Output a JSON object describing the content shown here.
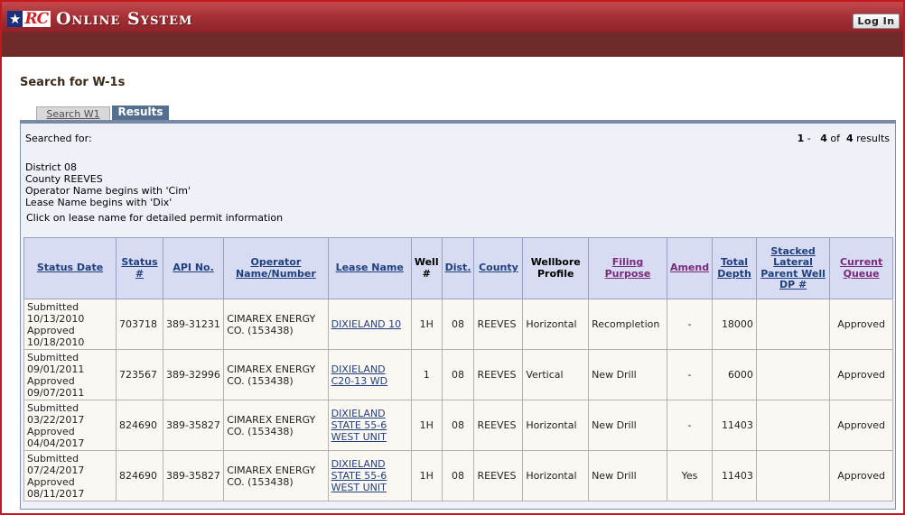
{
  "app": {
    "logo_star": "★",
    "logo_text": "RC",
    "title": "Online System",
    "login_label": "Log In"
  },
  "page": {
    "heading": "Search for W-1s"
  },
  "tabs": [
    {
      "label": "Search W1"
    },
    {
      "label": "Results"
    }
  ],
  "summary": {
    "searched_for": "Searched for:",
    "range_start": "1",
    "range_sep": "-",
    "range_end": "4",
    "of_label": "of",
    "total": "4",
    "results_label": "results"
  },
  "criteria": [
    "District 08",
    "County REEVES",
    "Operator Name begins with 'Cim'",
    "Lease Name begins with 'Dix'"
  ],
  "click_note": "Click on lease name for detailed permit information",
  "columns": {
    "status_date": "Status Date",
    "status_num": "Status #",
    "api_no": "API No.",
    "operator": "Operator Name/Number",
    "lease_name": "Lease Name",
    "well_num": "Well #",
    "dist": "Dist.",
    "county": "County",
    "wellbore": "Wellbore Profile",
    "filing": "Filing Purpose",
    "amend": "Amend",
    "total_depth": "Total Depth",
    "stacked": "Stacked Lateral Parent Well DP #",
    "queue": "Current Queue"
  },
  "rows": [
    {
      "submitted_label": "Submitted",
      "submitted_date": "10/13/2010",
      "approved_label": "Approved",
      "approved_date": "10/18/2010",
      "status_num": "703718",
      "api_no": "389-31231",
      "operator": "CIMAREX ENERGY CO. (153438)",
      "lease_name": "DIXIELAND 10",
      "well_num": "1H",
      "dist": "08",
      "county": "REEVES",
      "wellbore": "Horizontal",
      "filing": "Recompletion",
      "amend": "-",
      "total_depth": "18000",
      "stacked": "",
      "queue": "Approved"
    },
    {
      "submitted_label": "Submitted",
      "submitted_date": "09/01/2011",
      "approved_label": "Approved",
      "approved_date": "09/07/2011",
      "status_num": "723567",
      "api_no": "389-32996",
      "operator": "CIMAREX ENERGY CO. (153438)",
      "lease_name": "DIXIELAND C20-13 WD",
      "well_num": "1",
      "dist": "08",
      "county": "REEVES",
      "wellbore": "Vertical",
      "filing": "New Drill",
      "amend": "-",
      "total_depth": "6000",
      "stacked": "",
      "queue": "Approved"
    },
    {
      "submitted_label": "Submitted",
      "submitted_date": "03/22/2017",
      "approved_label": "Approved",
      "approved_date": "04/04/2017",
      "status_num": "824690",
      "api_no": "389-35827",
      "operator": "CIMAREX ENERGY CO. (153438)",
      "lease_name": "DIXIELAND STATE 55-6 WEST UNIT",
      "well_num": "1H",
      "dist": "08",
      "county": "REEVES",
      "wellbore": "Horizontal",
      "filing": "New Drill",
      "amend": "-",
      "total_depth": "11403",
      "stacked": "",
      "queue": "Approved"
    },
    {
      "submitted_label": "Submitted",
      "submitted_date": "07/24/2017",
      "approved_label": "Approved",
      "approved_date": "08/11/2017",
      "status_num": "824690",
      "api_no": "389-35827",
      "operator": "CIMAREX ENERGY CO. (153438)",
      "lease_name": "DIXIELAND STATE 55-6 WEST UNIT",
      "well_num": "1H",
      "dist": "08",
      "county": "REEVES",
      "wellbore": "Horizontal",
      "filing": "New Drill",
      "amend": "Yes",
      "total_depth": "11403",
      "stacked": "",
      "queue": "Approved"
    }
  ],
  "colors": {
    "banner": "#a83238",
    "subbanner": "#6f2a2a",
    "tab_active": "#54708f",
    "header_bg": "#d8dcf2",
    "link": "#1f3f7f",
    "visited_link": "#7a2a7a"
  }
}
